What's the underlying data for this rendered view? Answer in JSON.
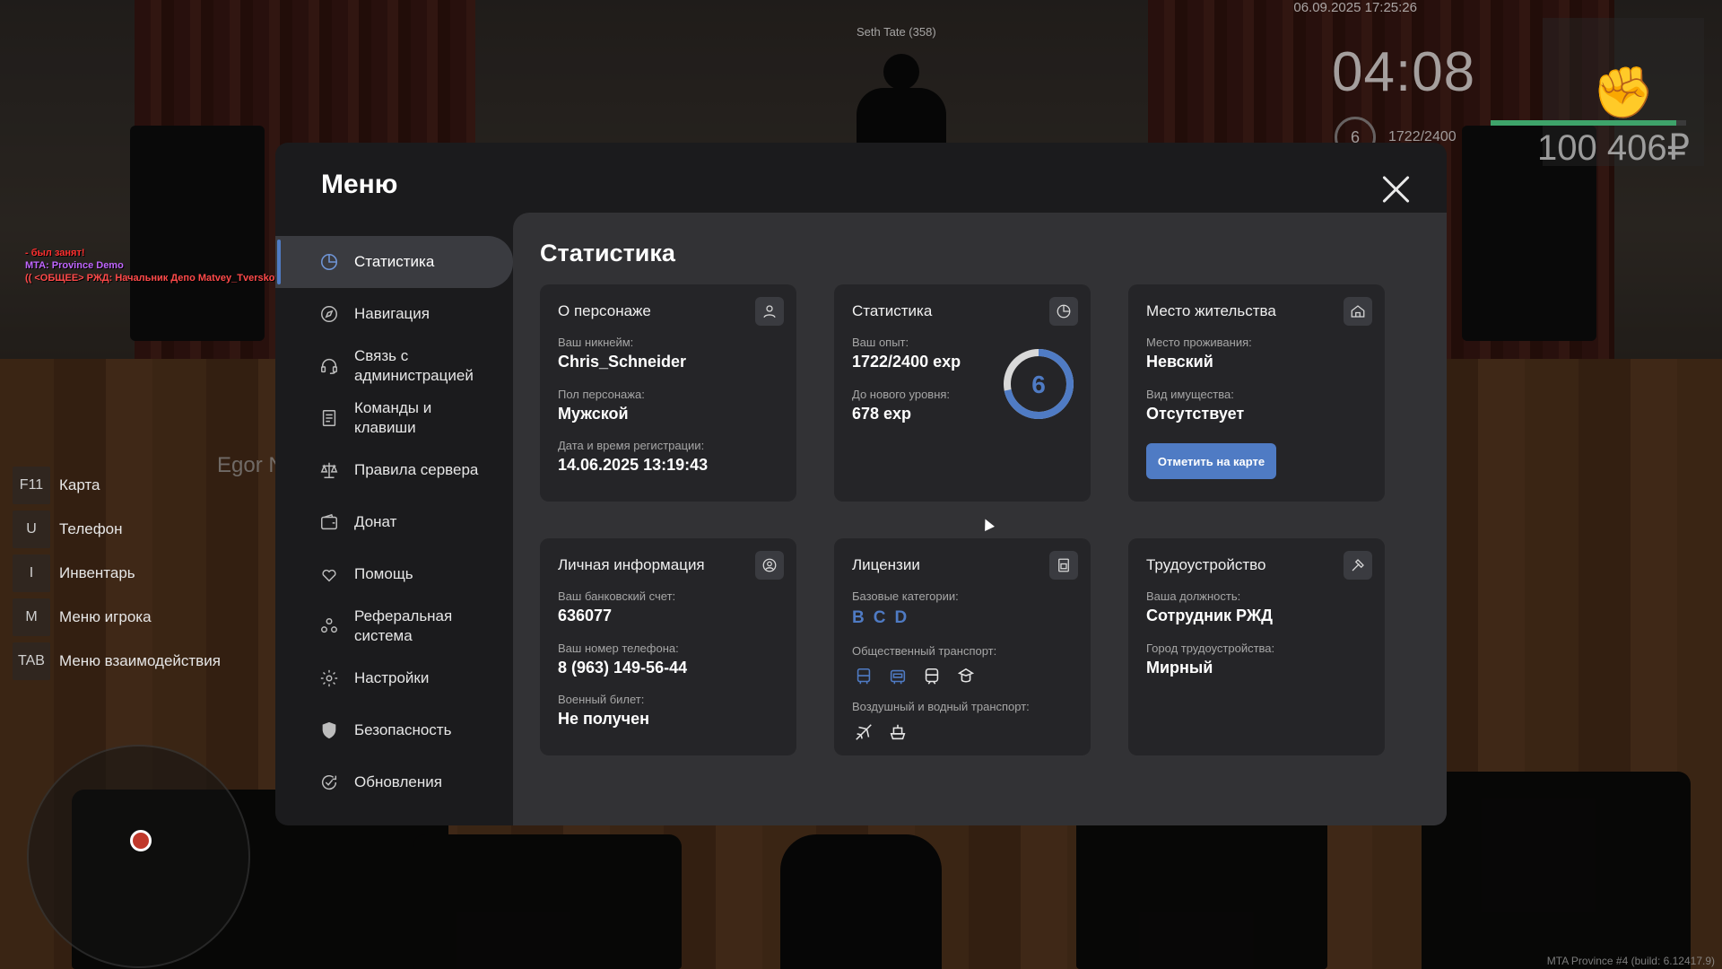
{
  "hud": {
    "datetime": "06.09.2025 17:25:26",
    "player_tag": "Seth Tate (358)",
    "time": "04:08",
    "level": "6",
    "exp": "1722/2400",
    "money": "100 406₽",
    "health_percent": 95,
    "chat": [
      "- был занят!",
      "MTA: Province Demo",
      "(( <ОБЩЕЕ> РЖД: Начальник Депо Matvey_Tverskoy[186]: приветик ))"
    ],
    "nearby_player": "Egor N",
    "hotkeys": [
      {
        "key": "F11",
        "label": "Карта"
      },
      {
        "key": "U",
        "label": "Телефон"
      },
      {
        "key": "I",
        "label": "Инвентарь"
      },
      {
        "key": "M",
        "label": "Меню игрока"
      },
      {
        "key": "TAB",
        "label": "Меню взаимодействия"
      }
    ],
    "build": "MTA Province #4 (build: 6.12417.9)"
  },
  "menu": {
    "title": "Меню",
    "items": [
      {
        "label": "Статистика",
        "icon": "pie-chart-icon"
      },
      {
        "label": "Навигация",
        "icon": "compass-icon"
      },
      {
        "label": "Связь с администрацией",
        "icon": "headset-icon"
      },
      {
        "label": "Команды и клавиши",
        "icon": "document-icon"
      },
      {
        "label": "Правила сервера",
        "icon": "scales-icon"
      },
      {
        "label": "Донат",
        "icon": "wallet-icon"
      },
      {
        "label": "Помощь",
        "icon": "heart-hand-icon"
      },
      {
        "label": "Реферальная система",
        "icon": "people-icon"
      },
      {
        "label": "Настройки",
        "icon": "gear-icon"
      },
      {
        "label": "Безопасность",
        "icon": "shield-icon"
      },
      {
        "label": "Обновления",
        "icon": "refresh-check-icon"
      }
    ]
  },
  "content": {
    "title": "Статистика",
    "character": {
      "title": "О персонаже",
      "nick_label": "Ваш никнейм:",
      "nick": "Chris_Schneider",
      "gender_label": "Пол персонажа:",
      "gender": "Мужской",
      "reg_label": "Дата и время регистрации:",
      "reg": "14.06.2025 13:19:43"
    },
    "stats": {
      "title": "Статистика",
      "exp_label": "Ваш опыт:",
      "exp": "1722/2400 exp",
      "next_label": "До нового уровня:",
      "next": "678 exp",
      "level": "6",
      "progress": 0.7175
    },
    "residence": {
      "title": "Место жительства",
      "place_label": "Место проживания:",
      "place": "Невский",
      "property_label": "Вид имущества:",
      "property": "Отсутствует",
      "button": "Отметить на карте"
    },
    "personal": {
      "title": "Личная информация",
      "bank_label": "Ваш банковский счет:",
      "bank": "636077",
      "phone_label": "Ваш номер телефона:",
      "phone": "8 (963) 149-56-44",
      "military_label": "Военный билет:",
      "military": "Не получен"
    },
    "licenses": {
      "title": "Лицензии",
      "base_label": "Базовые категории:",
      "categories": [
        "B",
        "C",
        "D"
      ],
      "public_label": "Общественный транспорт:",
      "public_icons": [
        "bus-icon",
        "trolleybus-icon",
        "train-icon",
        "tram-icon"
      ],
      "air_label": "Воздушный и водный транспорт:",
      "air_icons": [
        "plane-icon",
        "ship-icon"
      ]
    },
    "employment": {
      "title": "Трудоустройство",
      "position_label": "Ваша должность:",
      "position": "Сотрудник РЖД",
      "city_label": "Город трудоустройства:",
      "city": "Мирный"
    }
  },
  "colors": {
    "accent": "#4f7bc4",
    "panel": "#1b1b1d",
    "content": "#323235",
    "card": "#252528"
  }
}
